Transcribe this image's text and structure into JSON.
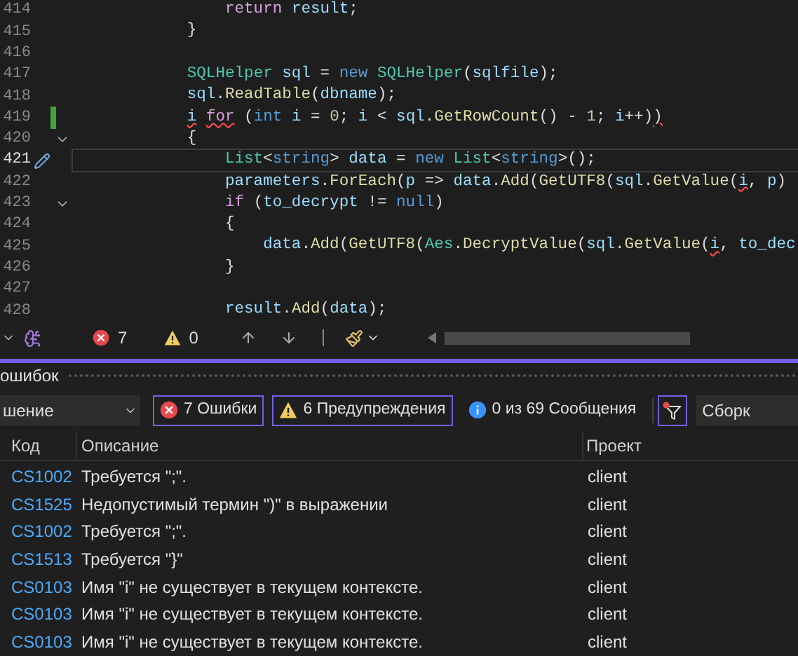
{
  "editor": {
    "lines": [
      {
        "number": "414",
        "current": false,
        "changed": false,
        "foldable": false,
        "tokens": [
          {
            "text": "                return",
            "kind": "ctl"
          },
          {
            "text": " result",
            "kind": "var"
          },
          {
            "text": ";",
            "kind": "p"
          }
        ]
      },
      {
        "number": "415",
        "current": false,
        "changed": false,
        "foldable": false,
        "tokens": [
          {
            "text": "            }",
            "kind": "p"
          }
        ]
      },
      {
        "number": "416",
        "current": false,
        "changed": false,
        "foldable": false
      },
      {
        "number": "417",
        "current": false,
        "changed": false,
        "foldable": false,
        "tokens": [
          {
            "text": "            SQLHelper",
            "kind": "type"
          },
          {
            "text": " sql",
            "kind": "var"
          },
          {
            "text": " = ",
            "kind": "p"
          },
          {
            "text": "new",
            "kind": "kw"
          },
          {
            "text": " SQLHelper",
            "kind": "type"
          },
          {
            "text": "(",
            "kind": "p"
          },
          {
            "text": "sqlfile",
            "kind": "var"
          },
          {
            "text": ");",
            "kind": "p"
          }
        ]
      },
      {
        "number": "418",
        "current": false,
        "changed": false,
        "foldable": false,
        "tokens": [
          {
            "text": "            sql",
            "kind": "var"
          },
          {
            "text": ".",
            "kind": "p"
          },
          {
            "text": "ReadTable",
            "kind": "fn"
          },
          {
            "text": "(",
            "kind": "p"
          },
          {
            "text": "dbname",
            "kind": "var"
          },
          {
            "text": ");",
            "kind": "p"
          }
        ]
      },
      {
        "number": "419",
        "current": false,
        "changed": true,
        "foldable": false,
        "tokens": [
          {
            "text": "            i",
            "kind": "var",
            "error": true
          },
          {
            "text": " for",
            "kind": "ctl",
            "error": true
          },
          {
            "text": " (",
            "kind": "p"
          },
          {
            "text": "int",
            "kind": "kw"
          },
          {
            "text": " i",
            "kind": "var"
          },
          {
            "text": " = ",
            "kind": "p"
          },
          {
            "text": "0",
            "kind": "num"
          },
          {
            "text": "; ",
            "kind": "p"
          },
          {
            "text": "i",
            "kind": "var"
          },
          {
            "text": " < ",
            "kind": "p"
          },
          {
            "text": "sql",
            "kind": "var"
          },
          {
            "text": ".",
            "kind": "p"
          },
          {
            "text": "GetRowCount",
            "kind": "fn"
          },
          {
            "text": "() - ",
            "kind": "p"
          },
          {
            "text": "1",
            "kind": "num"
          },
          {
            "text": "; ",
            "kind": "p"
          },
          {
            "text": "i",
            "kind": "var"
          },
          {
            "text": "++)",
            "kind": "p"
          },
          {
            "text": ")",
            "kind": "p",
            "error": true
          }
        ]
      },
      {
        "number": "420",
        "current": false,
        "changed": false,
        "foldable": true,
        "tokens": [
          {
            "text": "            {",
            "kind": "p"
          }
        ]
      },
      {
        "number": "421",
        "current": true,
        "changed": false,
        "foldable": false,
        "tokens": [
          {
            "text": "                List",
            "kind": "type"
          },
          {
            "text": "<",
            "kind": "p"
          },
          {
            "text": "string",
            "kind": "kw"
          },
          {
            "text": "> ",
            "kind": "p"
          },
          {
            "text": "data",
            "kind": "var"
          },
          {
            "text": " = ",
            "kind": "p"
          },
          {
            "text": "new",
            "kind": "kw"
          },
          {
            "text": " List",
            "kind": "type"
          },
          {
            "text": "<",
            "kind": "p"
          },
          {
            "text": "string",
            "kind": "kw"
          },
          {
            "text": ">();",
            "kind": "p"
          }
        ]
      },
      {
        "number": "422",
        "current": false,
        "changed": false,
        "foldable": false,
        "tokens": [
          {
            "text": "                parameters",
            "kind": "var"
          },
          {
            "text": ".",
            "kind": "p"
          },
          {
            "text": "ForEach",
            "kind": "fn"
          },
          {
            "text": "(",
            "kind": "p"
          },
          {
            "text": "p",
            "kind": "var"
          },
          {
            "text": " => ",
            "kind": "p"
          },
          {
            "text": "data",
            "kind": "var"
          },
          {
            "text": ".",
            "kind": "p"
          },
          {
            "text": "Add",
            "kind": "fn"
          },
          {
            "text": "(",
            "kind": "p"
          },
          {
            "text": "GetUTF8",
            "kind": "fn"
          },
          {
            "text": "(",
            "kind": "p"
          },
          {
            "text": "sql",
            "kind": "var"
          },
          {
            "text": ".",
            "kind": "p"
          },
          {
            "text": "GetValue",
            "kind": "fn"
          },
          {
            "text": "(",
            "kind": "p"
          },
          {
            "text": "i",
            "kind": "var",
            "error": true
          },
          {
            "text": ", ",
            "kind": "p"
          },
          {
            "text": "p",
            "kind": "var"
          },
          {
            "text": ")",
            "kind": "p"
          }
        ]
      },
      {
        "number": "423",
        "current": false,
        "changed": false,
        "foldable": true,
        "tokens": [
          {
            "text": "                if",
            "kind": "ctl"
          },
          {
            "text": " (",
            "kind": "p"
          },
          {
            "text": "to_decrypt",
            "kind": "var"
          },
          {
            "text": " != ",
            "kind": "p"
          },
          {
            "text": "null",
            "kind": "kw"
          },
          {
            "text": ")",
            "kind": "p"
          }
        ]
      },
      {
        "number": "424",
        "current": false,
        "changed": false,
        "foldable": false,
        "tokens": [
          {
            "text": "                {",
            "kind": "p"
          }
        ]
      },
      {
        "number": "425",
        "current": false,
        "changed": false,
        "foldable": false,
        "tokens": [
          {
            "text": "                    data",
            "kind": "var"
          },
          {
            "text": ".",
            "kind": "p"
          },
          {
            "text": "Add",
            "kind": "fn"
          },
          {
            "text": "(",
            "kind": "p"
          },
          {
            "text": "GetUTF8",
            "kind": "fn"
          },
          {
            "text": "(",
            "kind": "p"
          },
          {
            "text": "Aes",
            "kind": "type"
          },
          {
            "text": ".",
            "kind": "p"
          },
          {
            "text": "DecryptValue",
            "kind": "fn"
          },
          {
            "text": "(",
            "kind": "p"
          },
          {
            "text": "sql",
            "kind": "var"
          },
          {
            "text": ".",
            "kind": "p"
          },
          {
            "text": "GetValue",
            "kind": "fn"
          },
          {
            "text": "(",
            "kind": "p"
          },
          {
            "text": "i",
            "kind": "var",
            "error": true
          },
          {
            "text": ", ",
            "kind": "p"
          },
          {
            "text": "to_dec",
            "kind": "var"
          }
        ]
      },
      {
        "number": "426",
        "current": false,
        "changed": false,
        "foldable": false,
        "tokens": [
          {
            "text": "                }",
            "kind": "p"
          }
        ]
      },
      {
        "number": "427",
        "current": false,
        "changed": false,
        "foldable": false
      },
      {
        "number": "428",
        "current": false,
        "changed": false,
        "foldable": false,
        "tokens": [
          {
            "text": "                result",
            "kind": "var"
          },
          {
            "text": ".",
            "kind": "p"
          },
          {
            "text": "Add",
            "kind": "fn"
          },
          {
            "text": "(",
            "kind": "p"
          },
          {
            "text": "data",
            "kind": "var"
          },
          {
            "text": ");",
            "kind": "p"
          }
        ]
      }
    ]
  },
  "editor_status": {
    "errors": "7",
    "warnings": "0"
  },
  "error_list": {
    "title": "ошибок",
    "scope": "шение",
    "filters": [
      {
        "kind": "error",
        "label": "7 Ошибки",
        "selected": true
      },
      {
        "kind": "warning",
        "label": "6 Предупреждения",
        "selected": true
      },
      {
        "kind": "info",
        "label": "0 из 69 Сообщения",
        "selected": false
      }
    ],
    "build_dropdown": "Сборк",
    "columns": [
      "Код",
      "Описание",
      "Проект"
    ],
    "rows": [
      {
        "code": "CS1002",
        "description": "Требуется \";\".",
        "project": "client"
      },
      {
        "code": "CS1525",
        "description": "Недопустимый термин \")\" в выражении",
        "project": "client"
      },
      {
        "code": "CS1002",
        "description": "Требуется \";\".",
        "project": "client"
      },
      {
        "code": "CS1513",
        "description": "Требуется \"}\"",
        "project": "client"
      },
      {
        "code": "CS0103",
        "description": "Имя \"i\" не существует в текущем контексте.",
        "project": "client"
      },
      {
        "code": "CS0103",
        "description": "Имя \"i\" не существует в текущем контексте.",
        "project": "client"
      },
      {
        "code": "CS0103",
        "description": "Имя \"i\" не существует в текущем контексте.",
        "project": "client"
      }
    ]
  }
}
